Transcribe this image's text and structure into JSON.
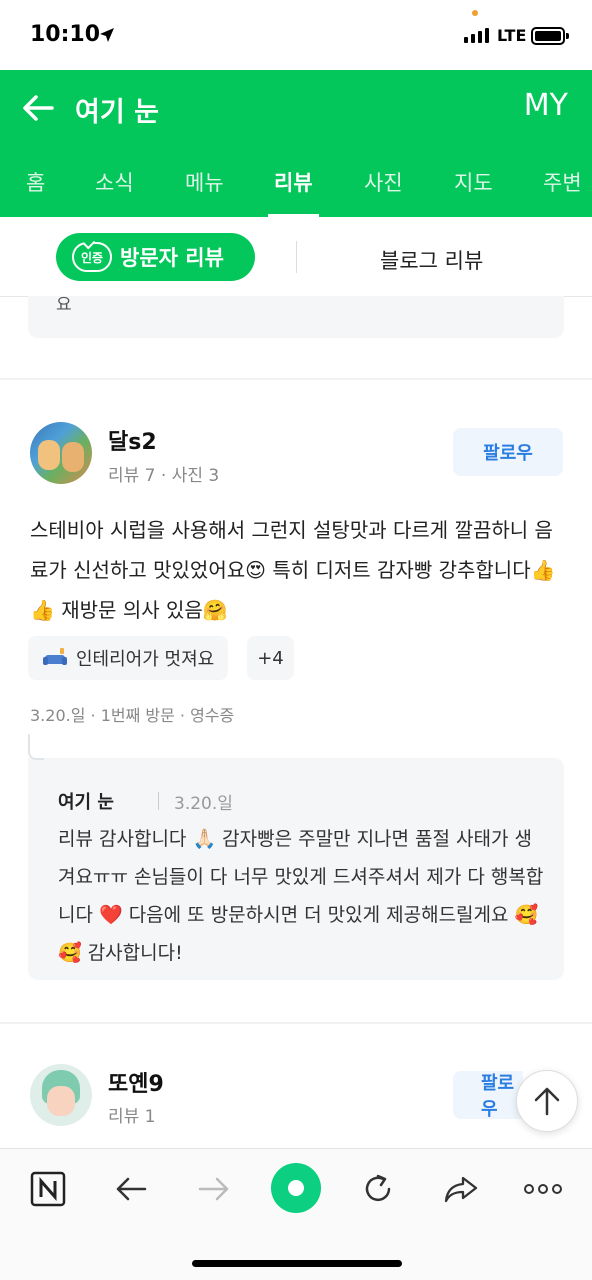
{
  "status": {
    "time": "10:10",
    "network": "LTE"
  },
  "header": {
    "title": "여기 눈",
    "my_label": "MY"
  },
  "tabs": [
    {
      "label": "홈"
    },
    {
      "label": "소식"
    },
    {
      "label": "메뉴"
    },
    {
      "label": "리뷰",
      "active": true
    },
    {
      "label": "사진"
    },
    {
      "label": "지도"
    },
    {
      "label": "주변"
    }
  ],
  "segments": {
    "visitor": "방문자 리뷰",
    "badge": "인증",
    "blog": "블로그 리뷰"
  },
  "previous_card": {
    "text": "요"
  },
  "review": {
    "author": "달s2",
    "stats": "리뷰 7 · 사진 3",
    "follow": "팔로우",
    "text": "스테비아 시럽을 사용해서 그런지 설탕맛과 다르게 깔끔하니 음료가 신선하고 맛있었어요😍 특히 디저트 감자빵 강추합니다👍👍 재방문 의사 있음🤗",
    "tags": [
      "인테리어가 멋져요",
      "+4"
    ],
    "visit_info": "3.20.일 · 1번째 방문 · 영수증",
    "reply": {
      "author": "여기 눈",
      "date": "3.20.일",
      "text": "리뷰 감사합니다 🙏🏻 감자빵은 주말만 지나면 품절 사태가 생겨요ㅠㅠ 손님들이 다 너무 맛있게 드셔주셔서 제가 다 행복합니다 ❤️ 다음에 또 방문하시면 더 맛있게 제공해드릴게요 🥰🥰 감사합니다!"
    }
  },
  "review2": {
    "author": "또옌9",
    "stats": "리뷰 1",
    "follow": "팔로우"
  },
  "colors": {
    "brand": "#03c75a",
    "follow_text": "#2a7de1"
  }
}
